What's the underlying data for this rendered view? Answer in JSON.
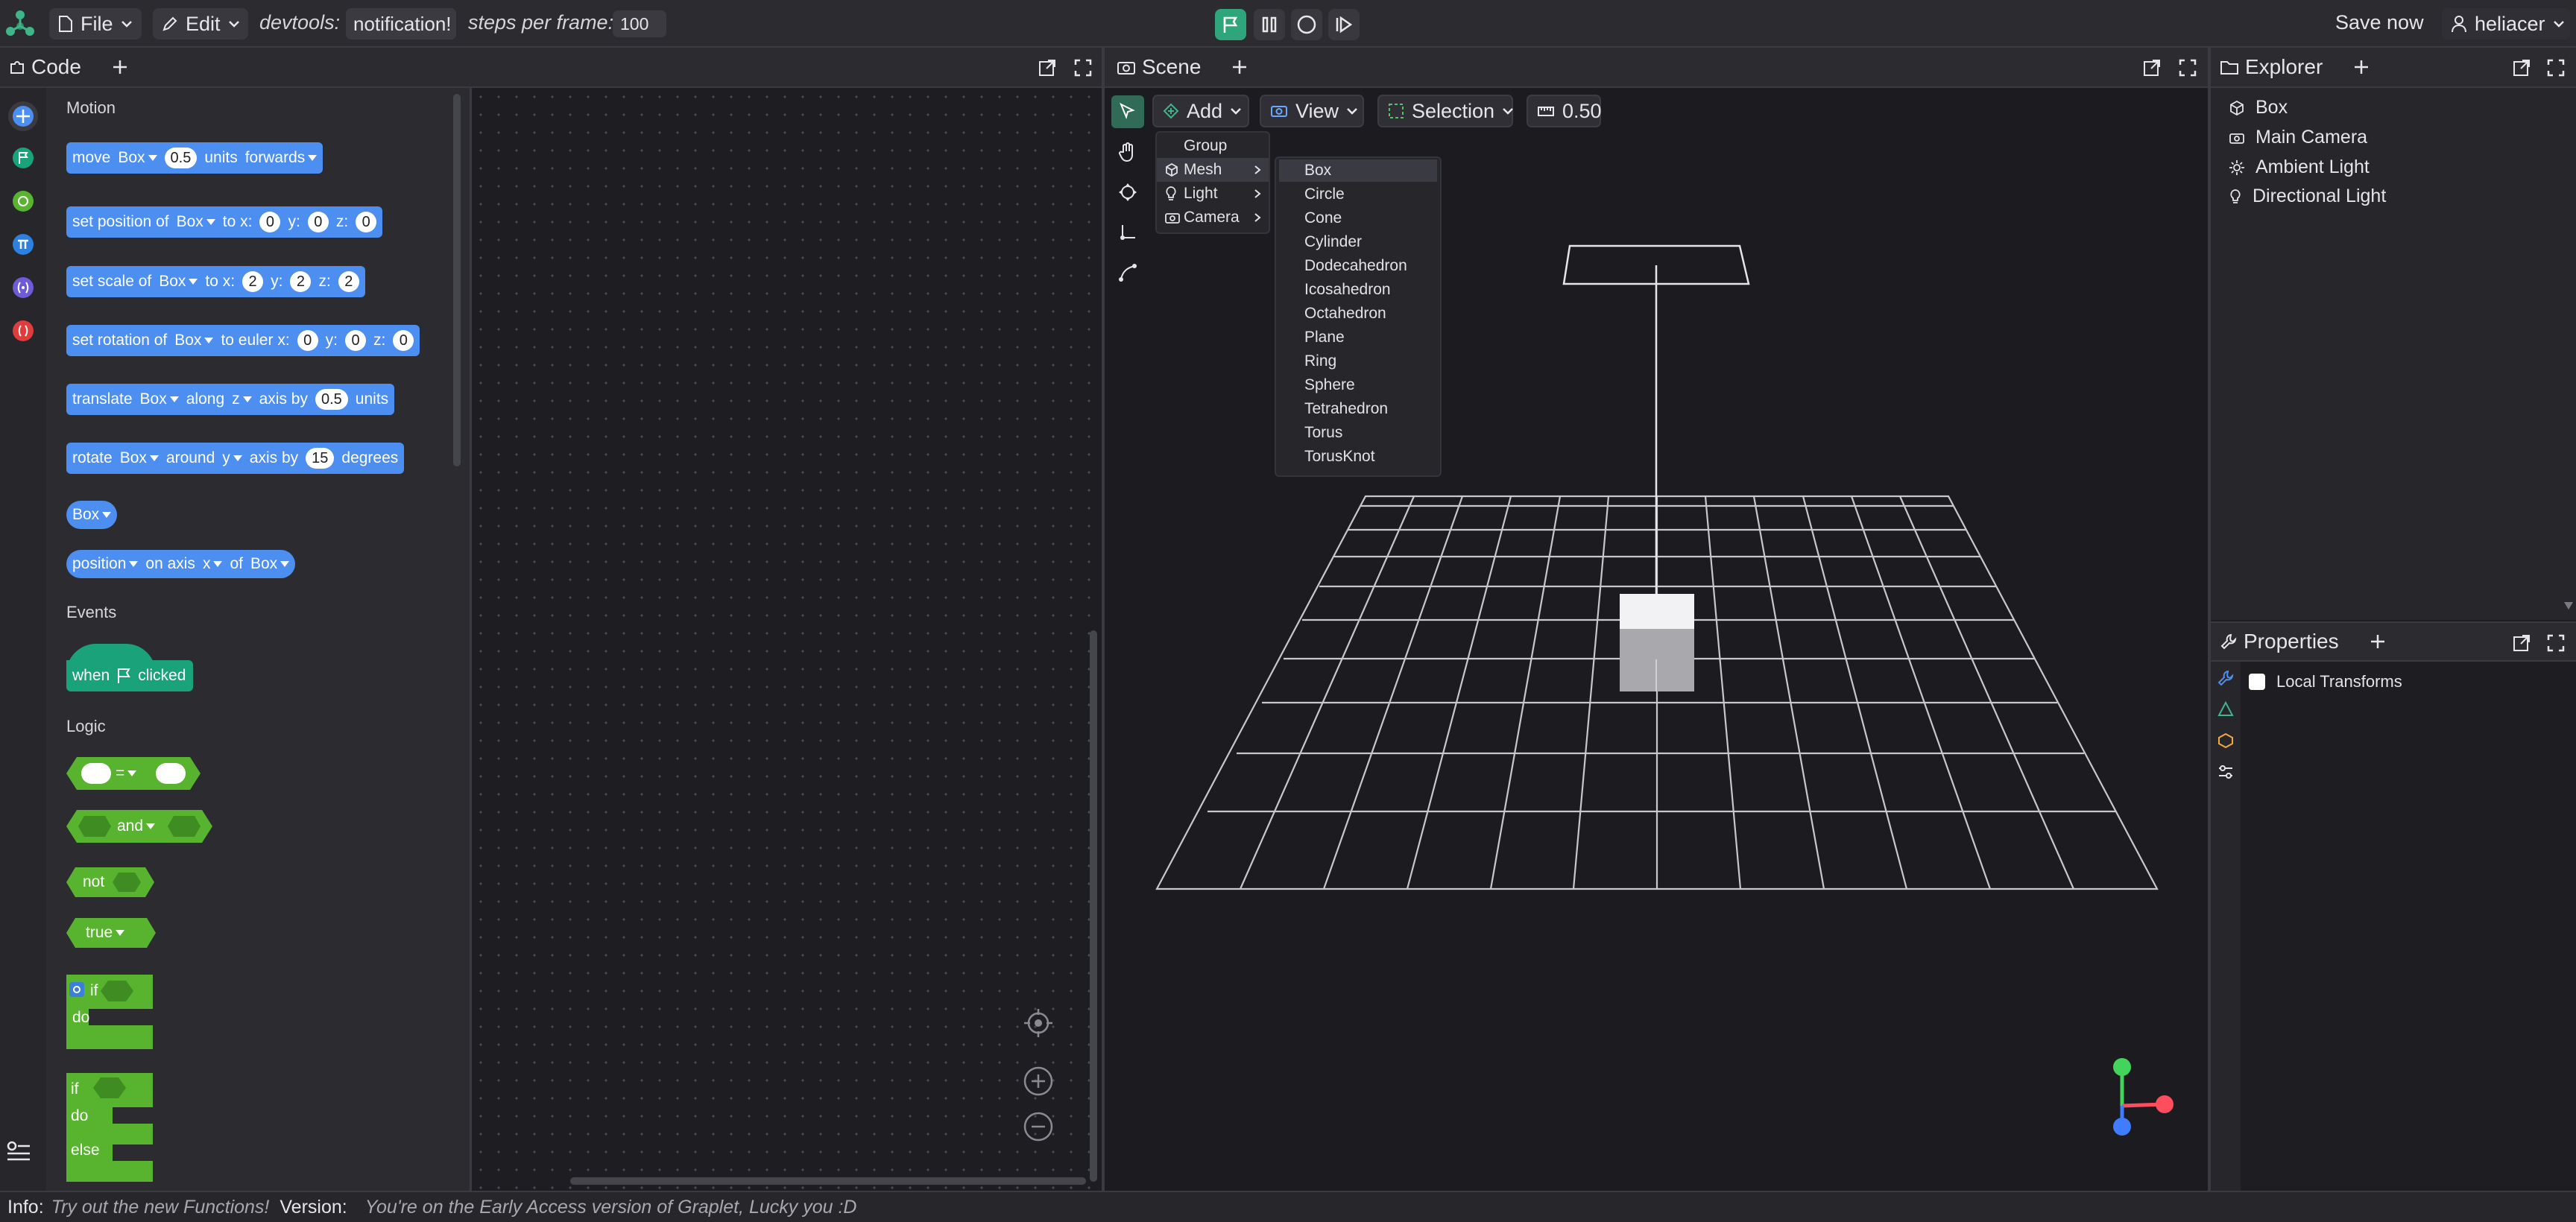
{
  "topbar": {
    "file_label": "File",
    "edit_label": "Edit",
    "devtools_label": "devtools:",
    "notification_label": "notification!",
    "steps_label": "steps per frame:",
    "steps_value": "100",
    "save_label": "Save now",
    "user_label": "heliacer"
  },
  "code_panel": {
    "title": "Code",
    "categories": {
      "motion": "Motion",
      "events": "Events",
      "logic": "Logic"
    },
    "blocks": {
      "move": {
        "a": "move",
        "obj": "Box",
        "val": "0.5",
        "b": "units",
        "dir": "forwards"
      },
      "setpos": {
        "a": "set position of",
        "obj": "Box",
        "b": "to x:",
        "x": "0",
        "yl": "y:",
        "y": "0",
        "zl": "z:",
        "z": "0"
      },
      "setscale": {
        "a": "set scale of",
        "obj": "Box",
        "b": "to x:",
        "x": "2",
        "yl": "y:",
        "y": "2",
        "zl": "z:",
        "z": "2"
      },
      "setrot": {
        "a": "set rotation of",
        "obj": "Box",
        "b": "to euler x:",
        "x": "0",
        "yl": "y:",
        "y": "0",
        "zl": "z:",
        "z": "0"
      },
      "translate": {
        "a": "translate",
        "obj": "Box",
        "b": "along",
        "axis": "z",
        "c": "axis by",
        "val": "0.5",
        "d": "units"
      },
      "rotate": {
        "a": "rotate",
        "obj": "Box",
        "b": "around",
        "axis": "y",
        "c": "axis by",
        "val": "15",
        "d": "degrees"
      },
      "boxref": {
        "obj": "Box"
      },
      "position": {
        "a": "position",
        "b": "on axis",
        "axis": "x",
        "c": "of",
        "obj": "Box"
      },
      "when": {
        "a": "when",
        "b": "clicked"
      },
      "equals": {
        "op": "="
      },
      "and": {
        "op": "and"
      },
      "not": {
        "a": "not"
      },
      "true": {
        "a": "true"
      },
      "if1": {
        "if": "if",
        "do": "do"
      },
      "if2": {
        "if": "if",
        "do": "do",
        "else": "else"
      }
    }
  },
  "scene_panel": {
    "title": "Scene",
    "add_label": "Add",
    "view_label": "View",
    "selection_label": "Selection",
    "snap_value": "0.50",
    "add_menu": [
      "Group",
      "Mesh",
      "Light",
      "Camera"
    ],
    "mesh_menu": [
      "Box",
      "Circle",
      "Cone",
      "Cylinder",
      "Dodecahedron",
      "Icosahedron",
      "Octahedron",
      "Plane",
      "Ring",
      "Sphere",
      "Tetrahedron",
      "Torus",
      "TorusKnot"
    ]
  },
  "explorer": {
    "title": "Explorer",
    "items": [
      "Box",
      "Main Camera",
      "Ambient Light",
      "Directional Light"
    ]
  },
  "properties": {
    "title": "Properties",
    "local_transforms": "Local Transforms"
  },
  "status": {
    "info_label": "Info:",
    "info_text": "Try out the new Functions!",
    "version_label": "Version:",
    "version_text": "You're on the Early Access version of Graplet, Lucky you :D"
  },
  "colors": {
    "accent": "#3fb58a",
    "motion_block": "#4c8ff0",
    "logic_block": "#58b32e",
    "event_block": "#1aa37a",
    "axis_x": "#ff4d5e",
    "axis_y": "#43d45c",
    "axis_z": "#3f7cff"
  }
}
